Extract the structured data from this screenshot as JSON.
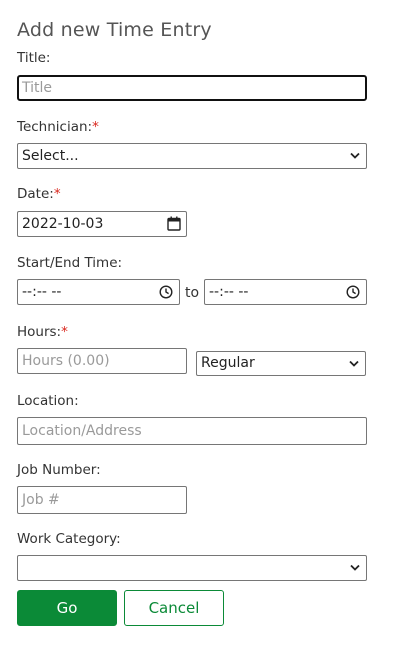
{
  "form": {
    "title": "Add new Time Entry",
    "title_field": {
      "label": "Title:",
      "placeholder": "Title"
    },
    "technician": {
      "label": "Technician:",
      "required_mark": "*",
      "selected": "Select..."
    },
    "date": {
      "label": "Date:",
      "required_mark": "*",
      "value": "2022-10-03"
    },
    "time": {
      "label": "Start/End Time:",
      "start_value": "--:-- --",
      "to_text": "to",
      "end_value": "--:-- --"
    },
    "hours": {
      "label": "Hours:",
      "required_mark": "*",
      "placeholder": "Hours (0.00)",
      "type_selected": "Regular"
    },
    "location": {
      "label": "Location:",
      "placeholder": "Location/Address"
    },
    "job_number": {
      "label": "Job Number:",
      "placeholder": "Job #"
    },
    "work_category": {
      "label": "Work Category:",
      "selected": ""
    },
    "buttons": {
      "go": "Go",
      "cancel": "Cancel"
    }
  },
  "colors": {
    "accent": "#0b8a37",
    "required": "#d9261c",
    "placeholder": "#9a9a9a"
  },
  "icons": {
    "select": "chevron-down-icon",
    "time": "clock-icon",
    "date": "calendar-icon"
  }
}
